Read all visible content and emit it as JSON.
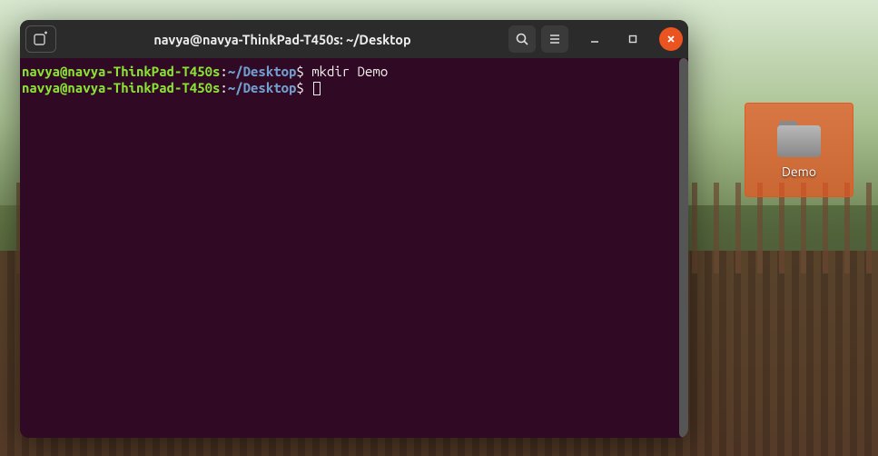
{
  "window": {
    "title": "navya@navya-ThinkPad-T450s: ~/Desktop"
  },
  "terminal": {
    "lines": [
      {
        "user_host": "navya@navya-ThinkPad-T450s",
        "sep1": ":",
        "cwd": "~/Desktop",
        "prompt": "$ ",
        "command": "mkdir Demo"
      },
      {
        "user_host": "navya@navya-ThinkPad-T450s",
        "sep1": ":",
        "cwd": "~/Desktop",
        "prompt": "$ ",
        "command": ""
      }
    ]
  },
  "desktop": {
    "folder_label": "Demo"
  }
}
